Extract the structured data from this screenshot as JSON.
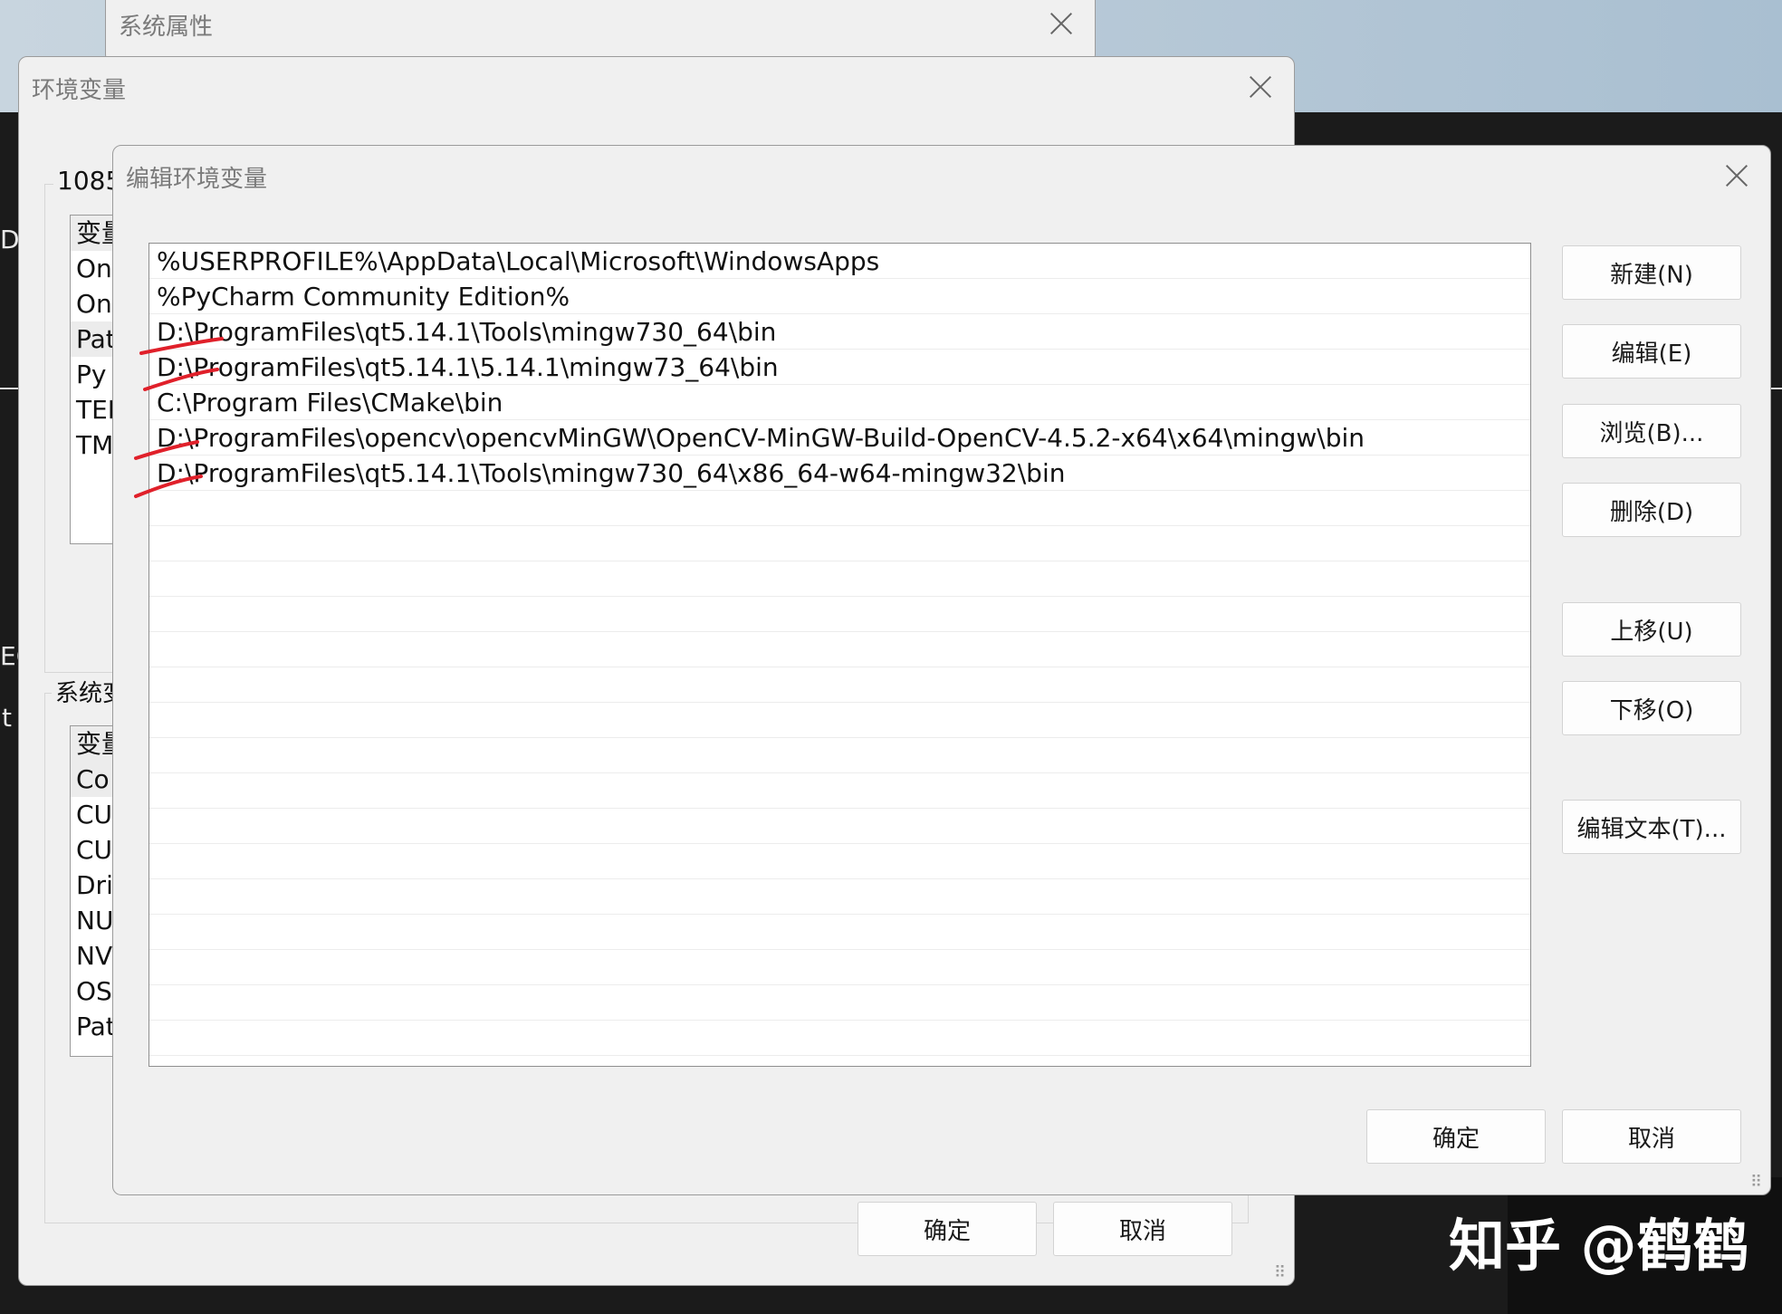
{
  "desktop": {
    "edge_text": [
      "D",
      "EC",
      "t"
    ]
  },
  "system_properties": {
    "title": "系统属性"
  },
  "env_vars": {
    "title": "环境变量",
    "user_group_label": "1085",
    "user_list": [
      "变量",
      "On",
      "On",
      "Pat",
      "Py",
      "TEN",
      "TM"
    ],
    "system_group_label": "系统变",
    "system_list": [
      "变量",
      "Co",
      "CU",
      "CU",
      "Dri",
      "NU",
      "NV",
      "OS",
      "Pat"
    ],
    "ok": "确定",
    "cancel": "取消"
  },
  "edit_dialog": {
    "title": "编辑环境变量",
    "paths": [
      "%USERPROFILE%\\AppData\\Local\\Microsoft\\WindowsApps",
      "%PyCharm Community Edition%",
      "D:\\ProgramFiles\\qt5.14.1\\Tools\\mingw730_64\\bin",
      "D:\\ProgramFiles\\qt5.14.1\\5.14.1\\mingw73_64\\bin",
      "C:\\Program Files\\CMake\\bin",
      "D:\\ProgramFiles\\opencv\\opencvMinGW\\OpenCV-MinGW-Build-OpenCV-4.5.2-x64\\x64\\mingw\\bin",
      "D:\\ProgramFiles\\qt5.14.1\\Tools\\mingw730_64\\x86_64-w64-mingw32\\bin"
    ],
    "buttons": {
      "new": "新建(N)",
      "edit": "编辑(E)",
      "browse": "浏览(B)...",
      "delete": "删除(D)",
      "move_up": "上移(U)",
      "move_down": "下移(O)",
      "edit_text": "编辑文本(T)...",
      "ok": "确定",
      "cancel": "取消"
    }
  },
  "annotation_color": "#e0202a",
  "watermark": "知乎 @鹤鹤"
}
